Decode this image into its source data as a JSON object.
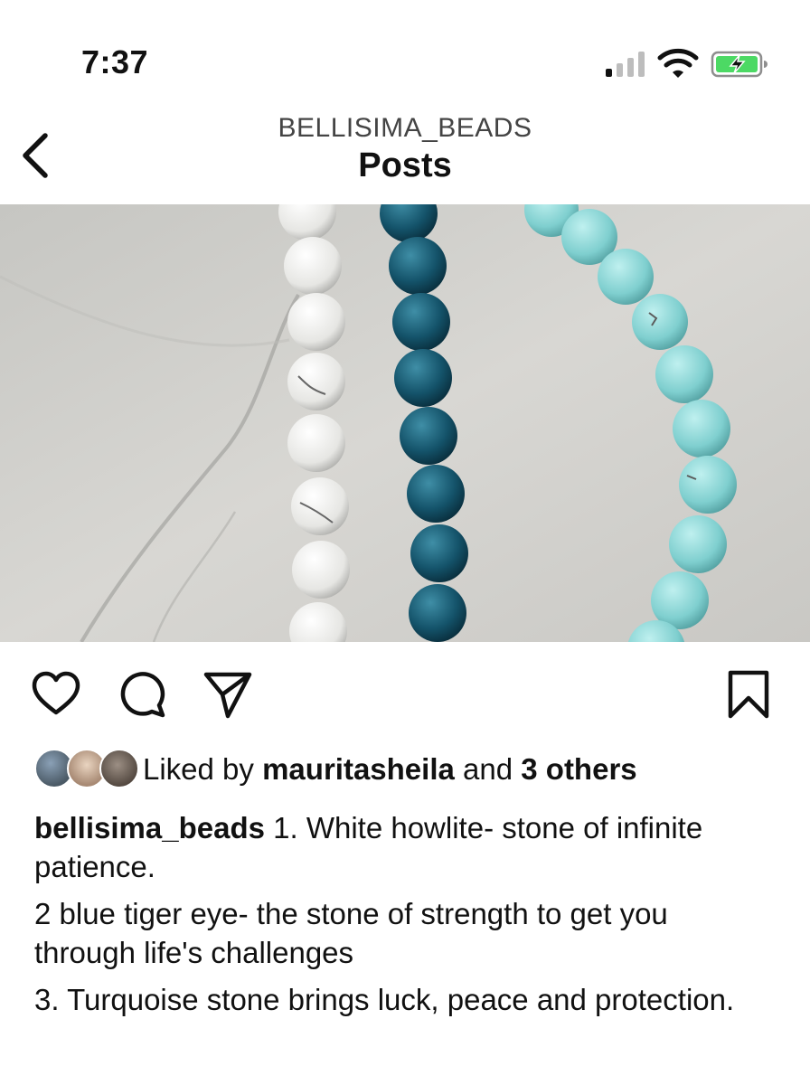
{
  "status_bar": {
    "time": "7:37",
    "signal_icon": "cellular-signal-icon",
    "wifi_icon": "wifi-icon",
    "battery_icon": "battery-charging-icon",
    "battery_color": "#4cd964"
  },
  "nav": {
    "account": "BELLISIMA_BEADS",
    "title": "Posts",
    "back_icon": "chevron-left-icon"
  },
  "post": {
    "image_icon": "photo",
    "actions": {
      "like_icon": "heart-icon",
      "comment_icon": "comment-icon",
      "share_icon": "send-icon",
      "save_icon": "bookmark-icon"
    },
    "likes": {
      "prefix": "Liked by",
      "user": "mauritasheila",
      "middle": "and",
      "others": "3 others"
    },
    "caption": {
      "username": "bellisima_beads",
      "line1": "1. White howlite- stone of infinite patience.",
      "line2": "2 blue tiger eye- the stone of strength to get you through life's challenges",
      "line3": "3. Turquoise stone brings luck, peace and protection."
    }
  }
}
